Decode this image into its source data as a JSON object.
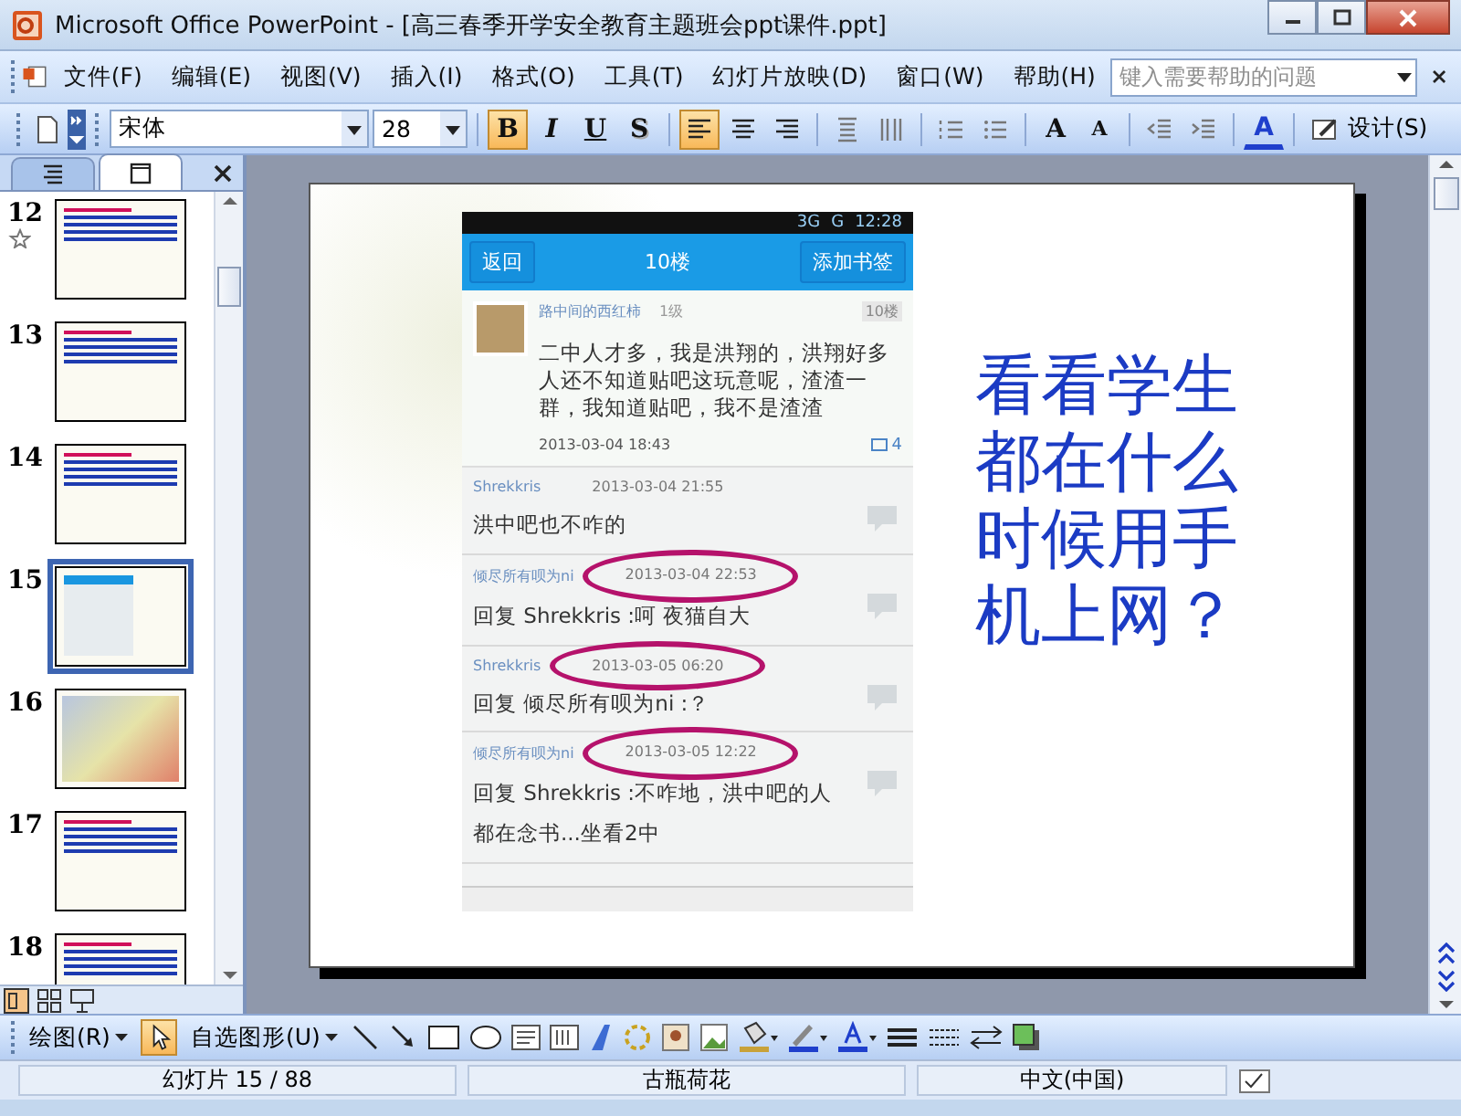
{
  "window": {
    "title": "Microsoft Office PowerPoint - [高三春季开学安全教育主题班会ppt课件.ppt]"
  },
  "menu": [
    "文件(F)",
    "编辑(E)",
    "视图(V)",
    "插入(I)",
    "格式(O)",
    "工具(T)",
    "幻灯片放映(D)",
    "窗口(W)",
    "帮助(H)"
  ],
  "help_search": {
    "placeholder": "键入需要帮助的问题"
  },
  "format_toolbar": {
    "font": "宋体",
    "size": "28",
    "design": "设计(S)",
    "buttons": [
      {
        "kind": "bold",
        "label": "B",
        "selected": true
      },
      {
        "kind": "italic",
        "label": "I",
        "selected": false
      },
      {
        "kind": "underline",
        "label": "U",
        "selected": false
      },
      {
        "kind": "shadow",
        "label": "S",
        "selected": false
      },
      {
        "kind": "align-left",
        "selected": true
      },
      {
        "kind": "align-center",
        "selected": false
      },
      {
        "kind": "align-right",
        "selected": false
      },
      {
        "kind": "spacing",
        "selected": false
      },
      {
        "kind": "columns",
        "selected": false
      },
      {
        "kind": "numbering",
        "selected": false
      },
      {
        "kind": "bullets",
        "selected": false
      },
      {
        "kind": "grow-font",
        "label": "A",
        "selected": false
      },
      {
        "kind": "shrink-font",
        "label": "A",
        "selected": false
      },
      {
        "kind": "outdent",
        "selected": false
      },
      {
        "kind": "indent",
        "selected": false
      },
      {
        "kind": "font-color",
        "label": "A",
        "selected": false
      }
    ]
  },
  "panel_tabs": [
    {
      "kind": "outline",
      "selected": false
    },
    {
      "kind": "slides",
      "selected": true
    }
  ],
  "thumbnails": [
    {
      "number": "12",
      "kind": "text",
      "selected": false,
      "animated": true
    },
    {
      "number": "13",
      "kind": "text",
      "selected": false,
      "animated": false
    },
    {
      "number": "14",
      "kind": "text",
      "selected": false,
      "animated": false
    },
    {
      "number": "15",
      "kind": "phone",
      "selected": true,
      "animated": false
    },
    {
      "number": "16",
      "kind": "cartoon",
      "selected": false,
      "animated": false
    },
    {
      "number": "17",
      "kind": "text",
      "selected": false,
      "animated": false
    },
    {
      "number": "18",
      "kind": "text",
      "selected": false,
      "animated": false
    }
  ],
  "slide": {
    "heading": "看看学生都在什么时候用手机上网？",
    "phone": {
      "signal": "3G",
      "network": "G",
      "time": "12:28",
      "back": "返回",
      "title": "10楼",
      "bookmark": "添加书签",
      "post": {
        "author": "路中间的西红柿",
        "level": "1级",
        "floor": "10楼",
        "text": "二中人才多，我是洪翔的，洪翔好多人还不知道贴吧这玩意呢，渣渣一群，我知道贴吧，我不是渣渣",
        "time": "2013-03-04 18:43",
        "comments": "4"
      },
      "replies": [
        {
          "author": "Shrekkris",
          "time": "2013-03-04 21:55",
          "text": "洪中吧也不咋的",
          "circled": false
        },
        {
          "author": "倾尽所有呗为ni",
          "time": "2013-03-04 22:53",
          "text": "回复 Shrekkris :呵 夜猫自大",
          "circled": true
        },
        {
          "author": "Shrekkris",
          "time": "2013-03-05 06:20",
          "text": "回复 倾尽所有呗为ni :？",
          "circled": true
        },
        {
          "author": "倾尽所有呗为ni",
          "time": "2013-03-05 12:22",
          "text": "回复 Shrekkris :不咋地，洪中吧的人都在念书...坐看2中",
          "circled": true
        }
      ]
    }
  },
  "drawing_toolbar": {
    "draw": "绘图(R)",
    "autoshapes": "自选图形(U)"
  },
  "status_bar": [
    "幻灯片 15 / 88",
    "古瓶荷花",
    "中文(中国)"
  ]
}
